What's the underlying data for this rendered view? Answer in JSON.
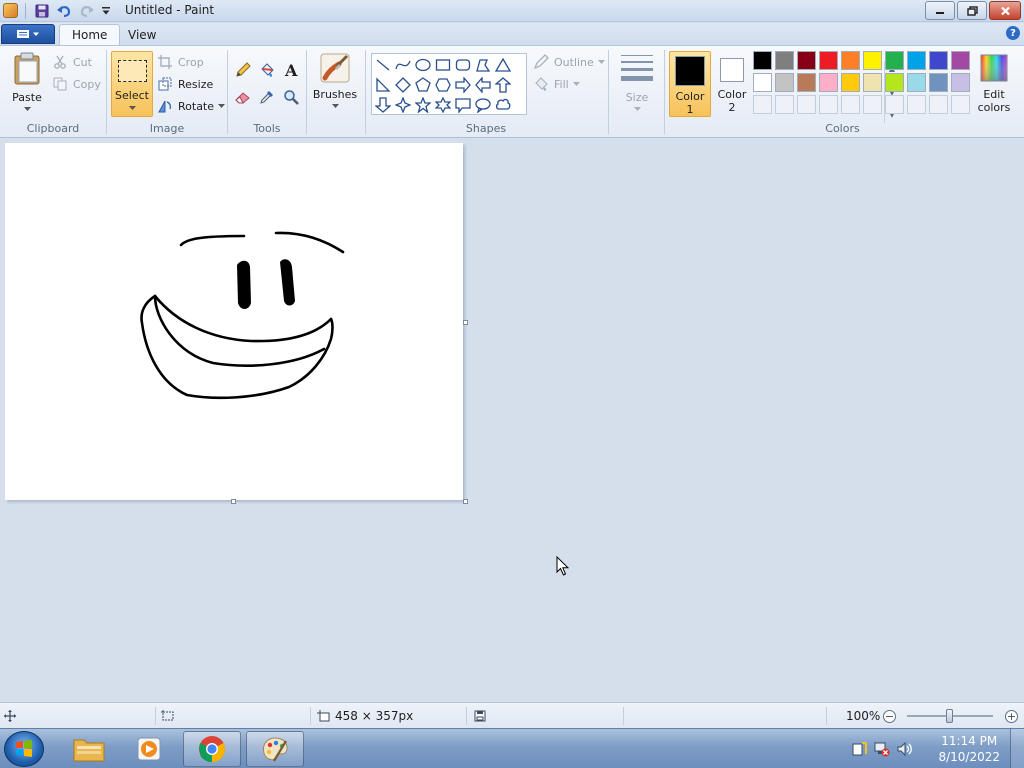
{
  "window": {
    "title": "Untitled - Paint"
  },
  "tabs": {
    "home": "Home",
    "view": "View"
  },
  "clipboard": {
    "group_label": "Clipboard",
    "paste": "Paste",
    "cut": "Cut",
    "copy": "Copy"
  },
  "image": {
    "group_label": "Image",
    "select": "Select",
    "crop": "Crop",
    "resize": "Resize",
    "rotate": "Rotate"
  },
  "tools": {
    "group_label": "Tools",
    "items": [
      "pencil-icon",
      "fill-icon",
      "text-icon",
      "eraser-icon",
      "color-picker-icon",
      "magnifier-icon"
    ]
  },
  "brushes": {
    "label": "Brushes"
  },
  "shapes": {
    "group_label": "Shapes",
    "outline": "Outline",
    "fill": "Fill"
  },
  "size": {
    "label": "Size"
  },
  "colors": {
    "group_label": "Colors",
    "color1_line1": "Color",
    "color1_line2": "1",
    "color2_line1": "Color",
    "color2_line2": "2",
    "edit_line1": "Edit",
    "edit_line2": "colors",
    "color1_value": "#000000",
    "color2_value": "#ffffff",
    "palette_row1": [
      "#000000",
      "#7f7f7f",
      "#880015",
      "#ed1c24",
      "#ff7f27",
      "#fff200",
      "#22b14c",
      "#00a2e8",
      "#3f48cc",
      "#a349a4"
    ],
    "palette_row2": [
      "#ffffff",
      "#c3c3c3",
      "#b97a57",
      "#ffaec9",
      "#ffc90e",
      "#efe4b0",
      "#b5e61d",
      "#99d9ea",
      "#7092be",
      "#c8bfe7"
    ]
  },
  "status": {
    "canvas_size": "458 × 357px",
    "zoom": "100%"
  },
  "taskbar": {
    "time": "11:14 PM",
    "date": "8/10/2022"
  }
}
